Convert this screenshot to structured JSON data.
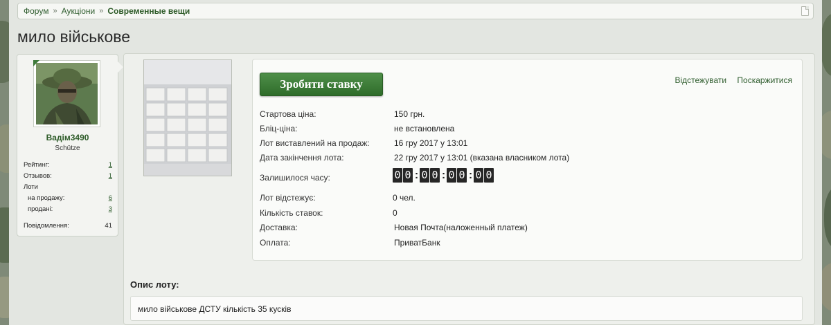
{
  "breadcrumb": {
    "items": [
      "Форум",
      "Аукціони"
    ],
    "current": "Современные вещи"
  },
  "page": {
    "title": "мило військове"
  },
  "user": {
    "name": "Вадім3490",
    "title": "Schütze",
    "stats": {
      "rating_label": "Рейтинг:",
      "rating": "1",
      "reviews_label": "Отзывов:",
      "reviews": "1",
      "lots_label": "Лоти",
      "for_sale_label": "на продажу:",
      "for_sale": "6",
      "sold_label": "продані:",
      "sold": "3",
      "posts_label": "Повідомлення:",
      "posts": "41"
    }
  },
  "lot": {
    "bid_button": "Зробити ставку",
    "watch_link": "Відстежувати",
    "report_link": "Поскаржитися",
    "fields": {
      "start_price_label": "Стартова ціна:",
      "start_price": "150 грн.",
      "blitz_label": "Бліц-ціна:",
      "blitz": "не встановлена",
      "listed_label": "Лот виставлений на продаж:",
      "listed": "16 гру 2017 у 13:01",
      "end_label": "Дата закінчення лота:",
      "end": "22 гру 2017 у 13:01 (вказана власником лота)",
      "remaining_label": "Залишилося часу:",
      "watchers_label": "Лот відстежує:",
      "watchers": "0 чел.",
      "bids_label": "Кількість ставок:",
      "bids": "0",
      "delivery_label": "Доставка:",
      "delivery": "Новая Почта(наложенный платеж)",
      "payment_label": "Оплата:",
      "payment": "ПриватБанк"
    },
    "timer": {
      "d1": "0",
      "d2": "0",
      "d3": "0",
      "d4": "0",
      "d5": "0",
      "d6": "0",
      "d7": "0",
      "d8": "0",
      "colon": ":"
    }
  },
  "description": {
    "heading": "Опис лоту:",
    "text": "мило військове ДСТУ кількість 35 кусків"
  },
  "colors": {
    "accent_green": "#2f6c2a",
    "link_green": "#2f5d2e"
  }
}
